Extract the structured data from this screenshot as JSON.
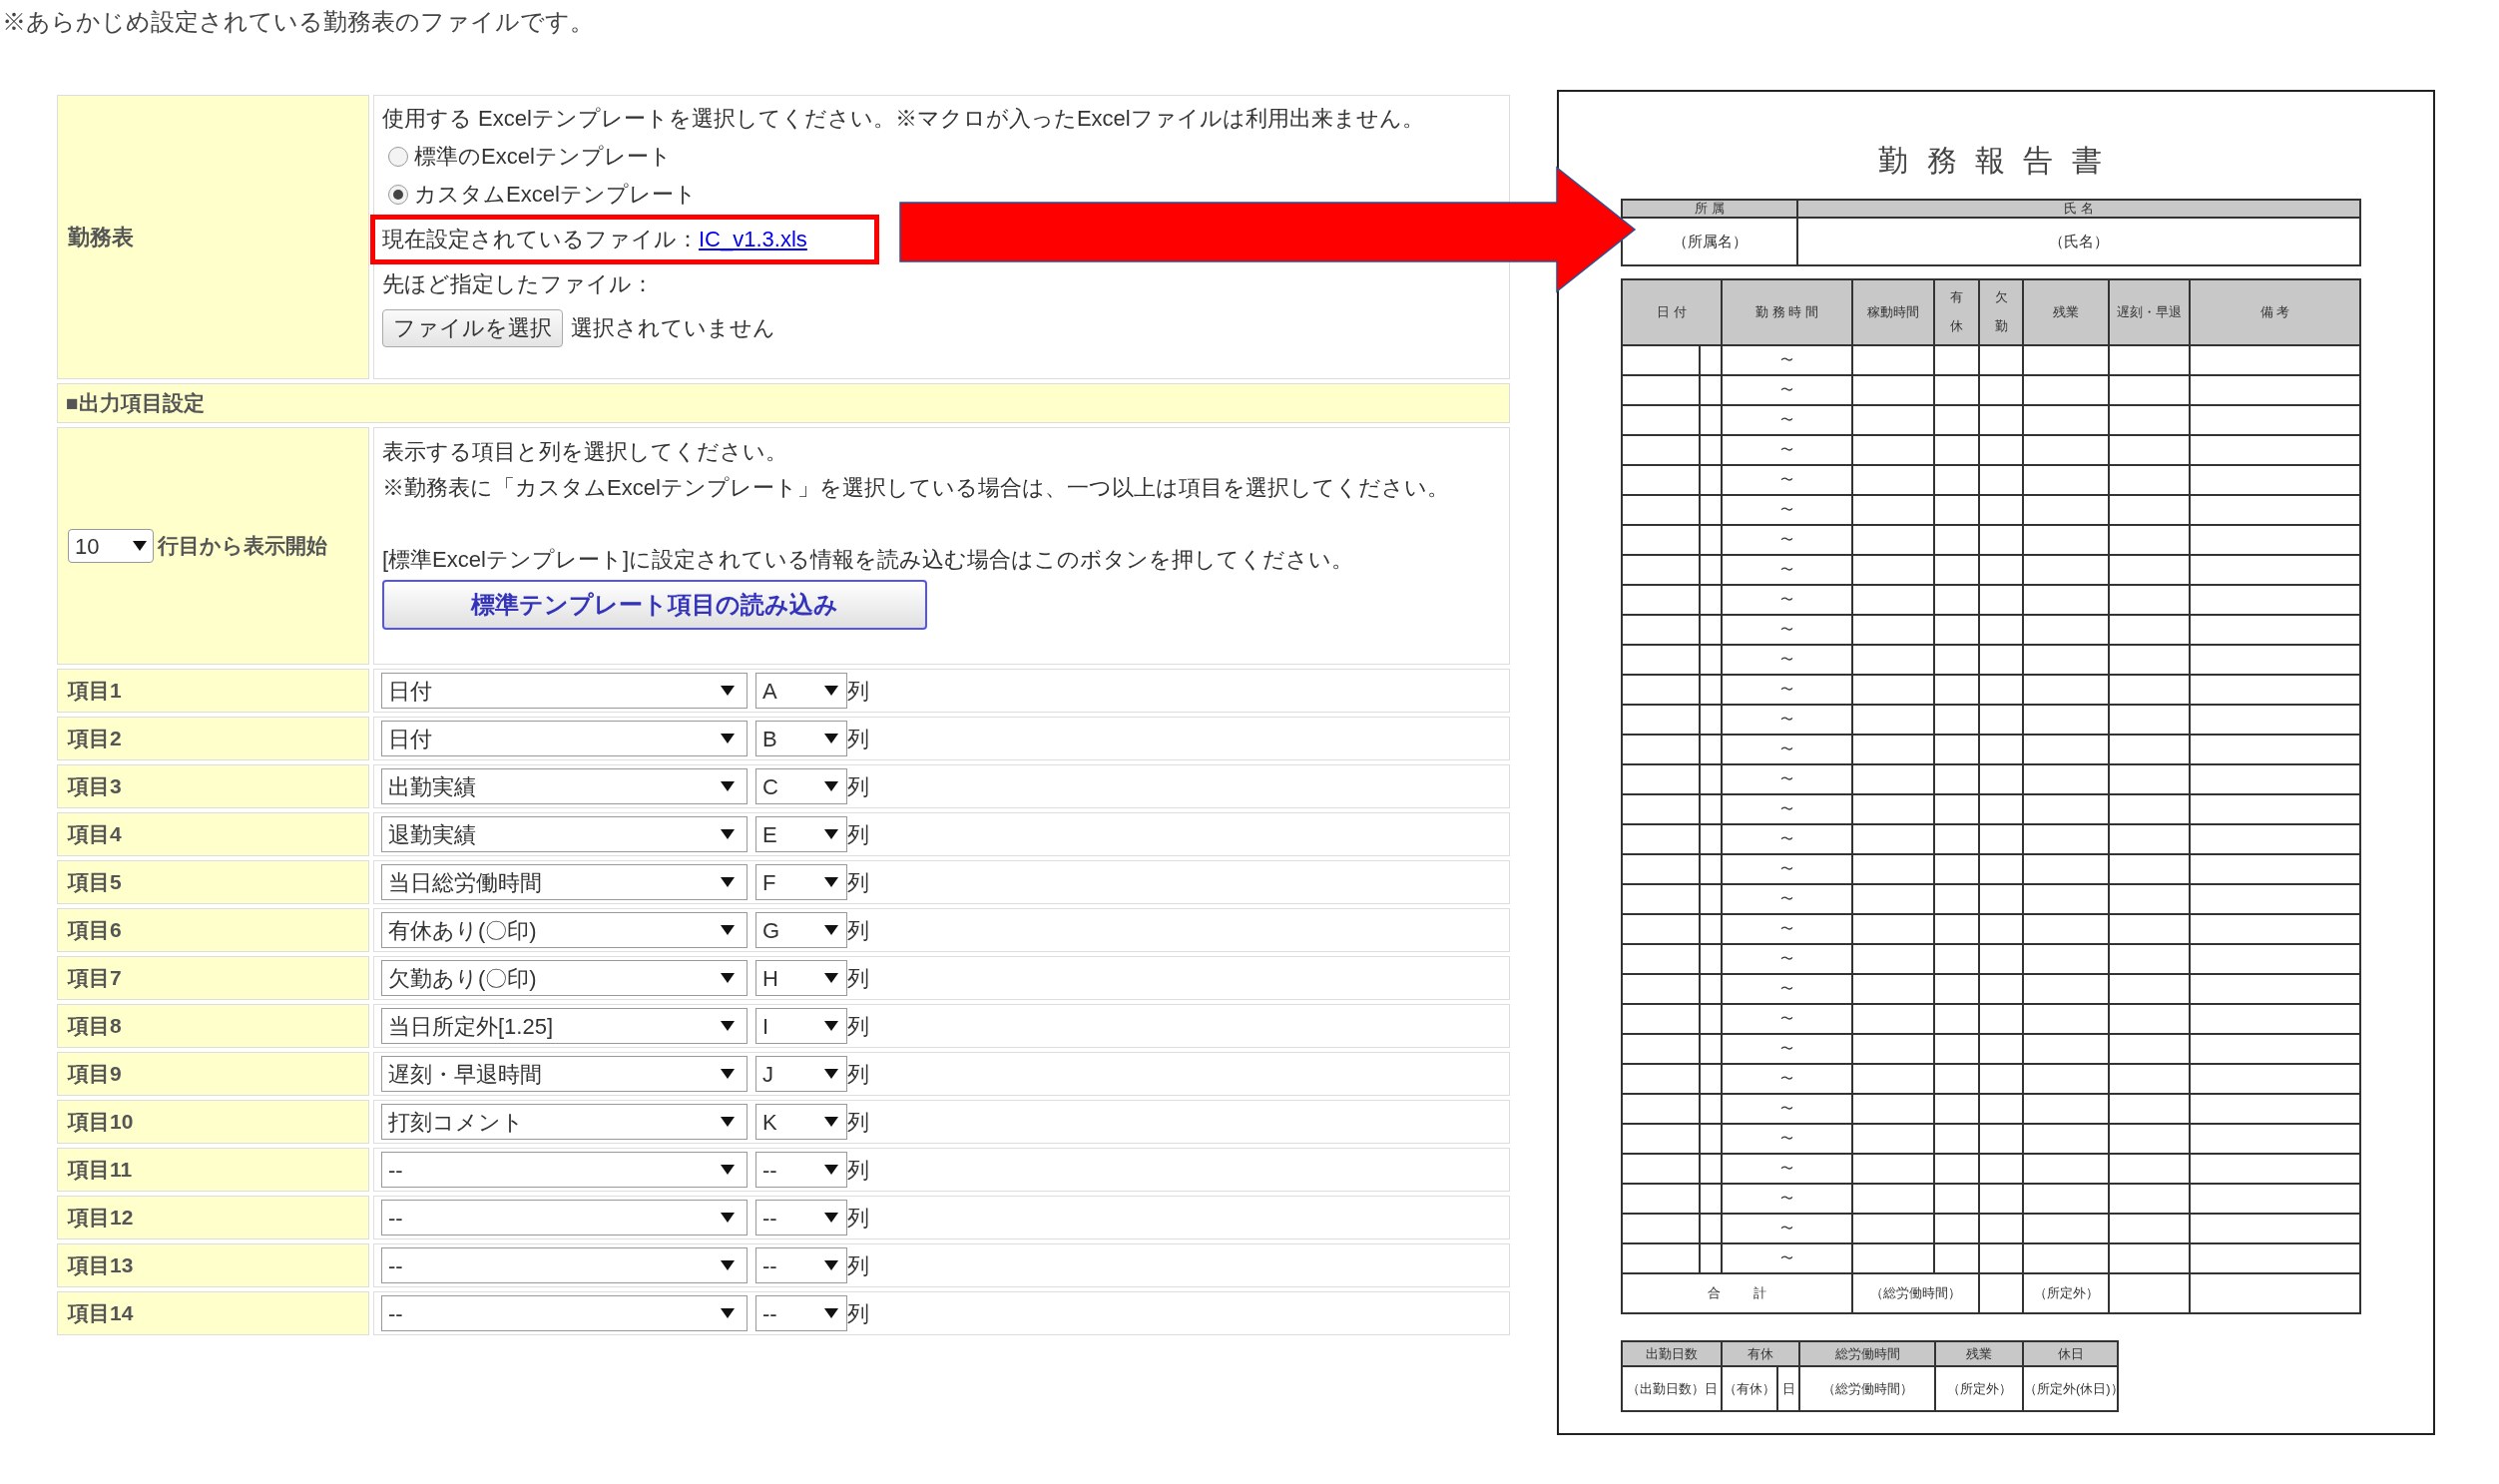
{
  "note": "※あらかじめ設定されている勤務表のファイルです。",
  "form": {
    "timesheet": {
      "label": "勤務表",
      "instruction": "使用する Excelテンプレートを選択してください。※マクロが入ったExcelファイルは利用出来ません。",
      "options": [
        {
          "label": "標準のExcelテンプレート",
          "selected": false
        },
        {
          "label": "カスタムExcelテンプレート",
          "selected": true
        }
      ],
      "current_file_label": "現在設定されているファイル：",
      "current_file_link": "IC_v1.3.xls",
      "previous_file_label": "先ほど指定したファイル：",
      "file_button": "ファイルを選択",
      "file_status": "選択されていません"
    },
    "section_title": "■出力項目設定",
    "start_row": {
      "value": "10",
      "suffix": "行目から表示開始"
    },
    "help": [
      "表示する項目と列を選択してください。",
      "※勤務表に「カスタムExcelテンプレート」を選択している場合は、一つ以上は項目を選択してください。",
      "[標準Excelテンプレート]に設定されている情報を読み込む場合はこのボタンを押してください。"
    ],
    "load_button": "標準テンプレート項目の読み込み",
    "items": [
      {
        "label": "項目1",
        "field": "日付",
        "column": "A",
        "suffix": "列"
      },
      {
        "label": "項目2",
        "field": "日付",
        "column": "B",
        "suffix": "列"
      },
      {
        "label": "項目3",
        "field": "出勤実績",
        "column": "C",
        "suffix": "列"
      },
      {
        "label": "項目4",
        "field": "退勤実績",
        "column": "E",
        "suffix": "列"
      },
      {
        "label": "項目5",
        "field": "当日総労働時間",
        "column": "F",
        "suffix": "列"
      },
      {
        "label": "項目6",
        "field": "有休あり(〇印)",
        "column": "G",
        "suffix": "列"
      },
      {
        "label": "項目7",
        "field": "欠勤あり(〇印)",
        "column": "H",
        "suffix": "列"
      },
      {
        "label": "項目8",
        "field": "当日所定外[1.25]",
        "column": "I",
        "suffix": "列"
      },
      {
        "label": "項目9",
        "field": "遅刻・早退時間",
        "column": "J",
        "suffix": "列"
      },
      {
        "label": "項目10",
        "field": "打刻コメント",
        "column": "K",
        "suffix": "列"
      },
      {
        "label": "項目11",
        "field": "--",
        "column": "--",
        "suffix": "列"
      },
      {
        "label": "項目12",
        "field": "--",
        "column": "--",
        "suffix": "列"
      },
      {
        "label": "項目13",
        "field": "--",
        "column": "--",
        "suffix": "列"
      },
      {
        "label": "項目14",
        "field": "--",
        "column": "--",
        "suffix": "列"
      }
    ]
  },
  "document": {
    "title": "勤 務 報 告 書",
    "affiliation_header": "所 属",
    "name_header": "氏 名",
    "affiliation": "（所属名）",
    "name": "（氏名）",
    "columns": [
      {
        "label": "日 付",
        "kind": "horizontal"
      },
      {
        "label": "勤 務 時 間",
        "kind": "horizontal"
      },
      {
        "label": "稼動時間",
        "kind": "horizontal"
      },
      {
        "label": "有休",
        "kind": "vertical"
      },
      {
        "label": "欠勤",
        "kind": "vertical"
      },
      {
        "label": "残業",
        "kind": "horizontal"
      },
      {
        "label": "遅刻・早退",
        "kind": "horizontal"
      },
      {
        "label": "備 考",
        "kind": "horizontal"
      }
    ],
    "rows": [
      {
        "time": "〜"
      },
      {
        "time": "〜"
      },
      {
        "time": "〜"
      },
      {
        "time": "〜"
      },
      {
        "time": "〜"
      },
      {
        "time": "〜"
      },
      {
        "time": "〜"
      },
      {
        "time": "〜"
      },
      {
        "time": "〜"
      },
      {
        "time": "〜"
      },
      {
        "time": "〜"
      },
      {
        "time": "〜"
      },
      {
        "time": "〜"
      },
      {
        "time": "〜"
      },
      {
        "time": "〜"
      },
      {
        "time": "〜"
      },
      {
        "time": "〜"
      },
      {
        "time": "〜"
      },
      {
        "time": "〜"
      },
      {
        "time": "〜"
      },
      {
        "time": "〜"
      },
      {
        "time": "〜"
      },
      {
        "time": "〜"
      },
      {
        "time": "〜"
      },
      {
        "time": "〜"
      },
      {
        "time": "〜"
      },
      {
        "time": "〜"
      },
      {
        "time": "〜"
      },
      {
        "time": "〜"
      },
      {
        "time": "〜"
      },
      {
        "time": "〜"
      }
    ],
    "total": {
      "label": "合 計",
      "hours": "（総労働時間）",
      "overtime": "（所定外）"
    },
    "summary": {
      "headers": [
        "出勤日数",
        "有休",
        "総労働時間",
        "残業",
        "休日"
      ],
      "values": [
        "（出勤日数）日",
        "（有休）",
        "日",
        "（総労働時間）",
        "（所定外）",
        "（所定外(休日)）"
      ]
    }
  }
}
